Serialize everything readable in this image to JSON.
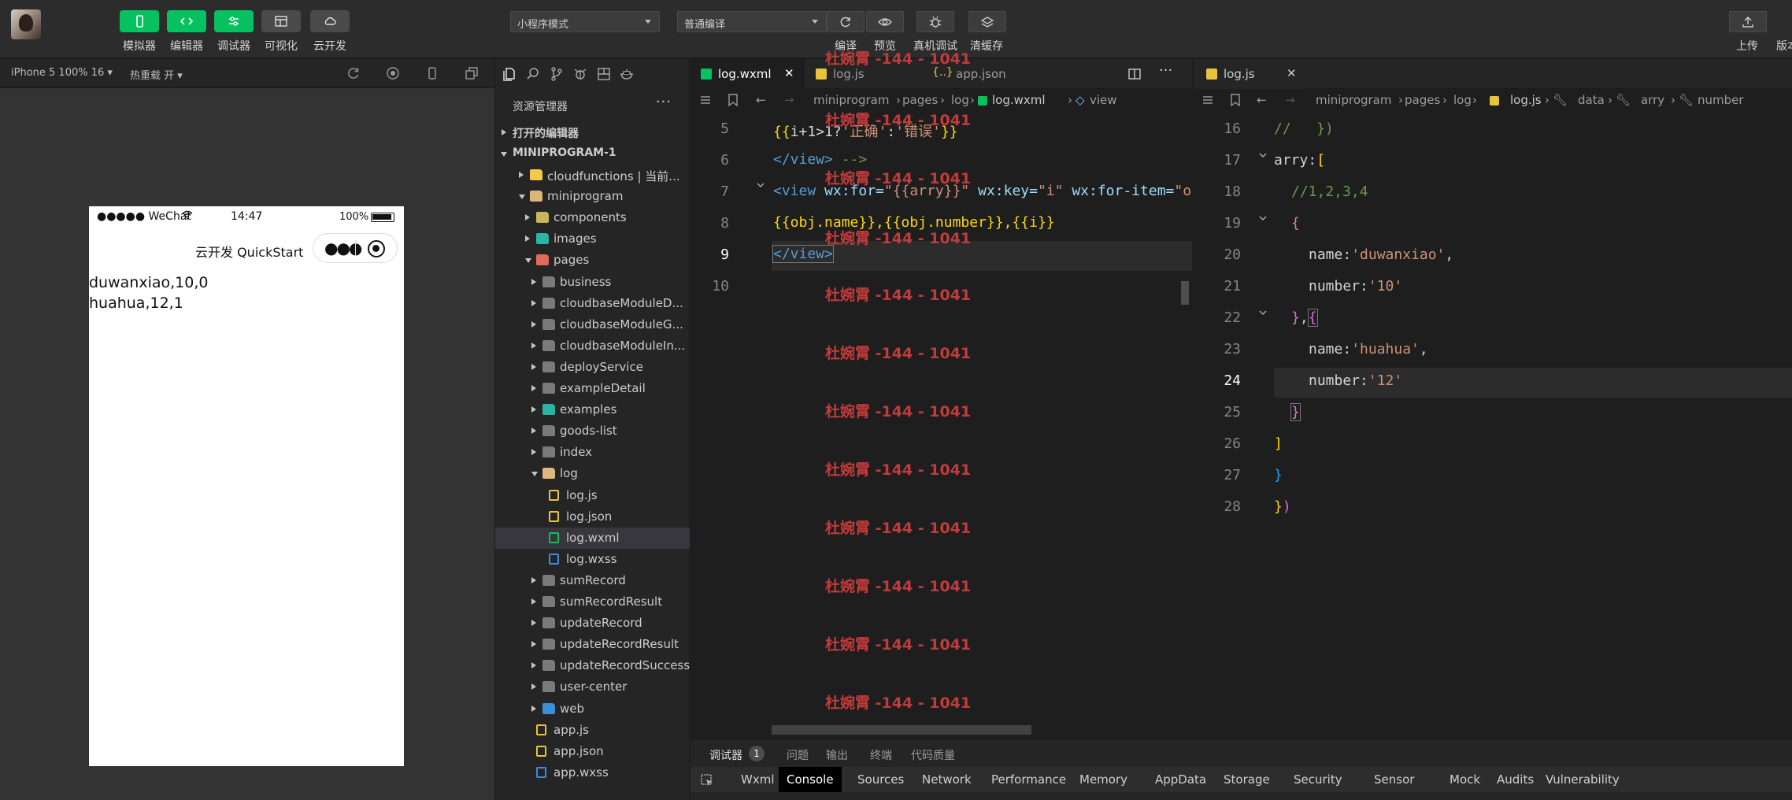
{
  "toolbar": {
    "mode_buttons": [
      "模拟器",
      "编辑器",
      "调试器",
      "可视化",
      "云开发"
    ],
    "mode_select": "小程序模式",
    "compile_select": "普通编译",
    "actions": [
      "编译",
      "预览",
      "真机调试",
      "清缓存"
    ],
    "right_actions": [
      "上传",
      "版本"
    ]
  },
  "simulator": {
    "device": "iPhone 5 100% 16 ▾",
    "hot_reload": "热重载 开 ▾",
    "status_left": "●●●●● WeChat",
    "status_time": "14:47",
    "status_battery": "100%",
    "nav_title": "云开发 QuickStart",
    "lines": [
      "duwanxiao,10,0",
      "huahua,12,1"
    ]
  },
  "explorer": {
    "title": "资源管理器",
    "more": "···",
    "open_editors": "打开的编辑器",
    "project": "MINIPROGRAM-1",
    "rows": [
      {
        "label": "cloudfunctions | 当前...",
        "depth": 1,
        "arrow": "right",
        "icon": "folder-cloud"
      },
      {
        "label": "miniprogram",
        "depth": 1,
        "arrow": "down",
        "icon": "folder-open"
      },
      {
        "label": "components",
        "depth": 2,
        "arrow": "right",
        "icon": "folder-special"
      },
      {
        "label": "images",
        "depth": 2,
        "arrow": "right",
        "icon": "folder-images"
      },
      {
        "label": "pages",
        "depth": 2,
        "arrow": "down",
        "icon": "folder-pages"
      },
      {
        "label": "business",
        "depth": 3,
        "arrow": "right",
        "icon": "folder"
      },
      {
        "label": "cloudbaseModuleD...",
        "depth": 3,
        "arrow": "right",
        "icon": "folder"
      },
      {
        "label": "cloudbaseModuleG...",
        "depth": 3,
        "arrow": "right",
        "icon": "folder"
      },
      {
        "label": "cloudbaseModuleIn...",
        "depth": 3,
        "arrow": "right",
        "icon": "folder"
      },
      {
        "label": "deployService",
        "depth": 3,
        "arrow": "right",
        "icon": "folder"
      },
      {
        "label": "exampleDetail",
        "depth": 3,
        "arrow": "right",
        "icon": "folder"
      },
      {
        "label": "examples",
        "depth": 3,
        "arrow": "right",
        "icon": "folder-teal"
      },
      {
        "label": "goods-list",
        "depth": 3,
        "arrow": "right",
        "icon": "folder"
      },
      {
        "label": "index",
        "depth": 3,
        "arrow": "right",
        "icon": "folder"
      },
      {
        "label": "log",
        "depth": 3,
        "arrow": "down",
        "icon": "folder-open"
      },
      {
        "label": "log.js",
        "depth": 4,
        "arrow": "",
        "icon": "js-file"
      },
      {
        "label": "log.json",
        "depth": 4,
        "arrow": "",
        "icon": "json-file"
      },
      {
        "label": "log.wxml",
        "depth": 4,
        "arrow": "",
        "icon": "wxml-file",
        "selected": true
      },
      {
        "label": "log.wxss",
        "depth": 4,
        "arrow": "",
        "icon": "wxss-file"
      },
      {
        "label": "sumRecord",
        "depth": 3,
        "arrow": "right",
        "icon": "folder"
      },
      {
        "label": "sumRecordResult",
        "depth": 3,
        "arrow": "right",
        "icon": "folder"
      },
      {
        "label": "updateRecord",
        "depth": 3,
        "arrow": "right",
        "icon": "folder"
      },
      {
        "label": "updateRecordResult",
        "depth": 3,
        "arrow": "right",
        "icon": "folder"
      },
      {
        "label": "updateRecordSuccess",
        "depth": 3,
        "arrow": "right",
        "icon": "folder"
      },
      {
        "label": "user-center",
        "depth": 3,
        "arrow": "right",
        "icon": "folder"
      },
      {
        "label": "web",
        "depth": 3,
        "arrow": "right",
        "icon": "folder-web"
      },
      {
        "label": "app.js",
        "depth": 2,
        "arrow": "",
        "icon": "js-file"
      },
      {
        "label": "app.json",
        "depth": 2,
        "arrow": "",
        "icon": "json-file"
      },
      {
        "label": "app.wxss",
        "depth": 2,
        "arrow": "",
        "icon": "wxss-file"
      }
    ]
  },
  "editor_left": {
    "tabs": [
      "log.wxml",
      "log.js",
      "app.json"
    ],
    "close": "✕",
    "breadcrumbs": [
      "miniprogram",
      "pages",
      "log",
      "log.wxml",
      "view"
    ],
    "line_numbers": [
      "5",
      "6",
      "7",
      "8",
      "9",
      "10"
    ],
    "code": {
      "l5a": "{{",
      "l5b": "i+1>1?",
      "l5c": "'正确'",
      "l5d": ":",
      "l5e": "'错误'",
      "l5f": "}}",
      "l6a": "</view>",
      "l6b": " -->",
      "l7a": "<view",
      "l7b": " wx:for=",
      "l7c": "\"{{arry}}\"",
      "l7d": " wx:key=",
      "l7e": "\"i\"",
      "l7f": " wx:for-item=",
      "l7g": "\"o",
      "l8": "{{obj.name}},{{obj.number}},{{i}}",
      "l9": "</view>"
    }
  },
  "editor_right": {
    "tab": "log.js",
    "close": "✕",
    "breadcrumbs": [
      "miniprogram",
      "pages",
      "log",
      "log.js",
      "data",
      "arry",
      "number"
    ],
    "line_numbers": [
      "16",
      "17",
      "18",
      "19",
      "20",
      "21",
      "22",
      "23",
      "24",
      "25",
      "26",
      "27",
      "28"
    ],
    "code": {
      "l16": "//   })",
      "l17a": "arry:",
      "l17b": "[",
      "l18": "//1,2,3,4",
      "l19": "{",
      "l20a": "name:",
      "l20b": "'duwanxiao'",
      "l20c": ",",
      "l21a": "number:",
      "l21b": "'10'",
      "l22a": "}",
      "l22b": ",",
      "l22c": "{",
      "l23a": "name:",
      "l23b": "'huahua'",
      "l23c": ",",
      "l24a": "number:",
      "l24b": "'12'",
      "l25": "}",
      "l26": "]",
      "l27": "}",
      "l28a": "}",
      "l28b": ")"
    }
  },
  "watermark": "杜婉霄 -144 - 1041",
  "bottom_panel": {
    "tabs": [
      "调试器",
      "问题",
      "输出",
      "终端",
      "代码质量"
    ],
    "badge": "1",
    "devtools_tabs": [
      "Wxml",
      "Console",
      "Sources",
      "Network",
      "Performance",
      "Memory",
      "AppData",
      "Storage",
      "Security",
      "Sensor",
      "Mock",
      "Audits",
      "Vulnerability"
    ]
  }
}
